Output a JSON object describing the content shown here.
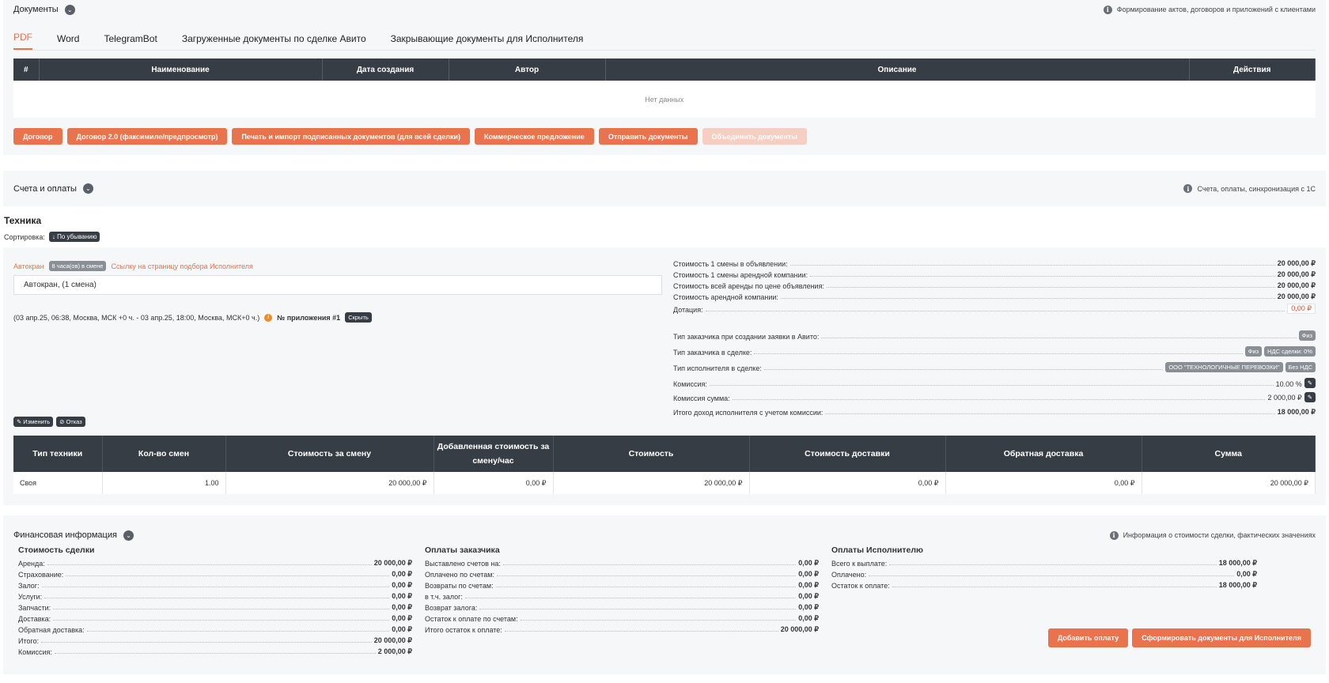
{
  "documents": {
    "title": "Документы",
    "info": "Формирование актов, договоров и приложений с клиентами",
    "tabs": [
      "PDF",
      "Word",
      "TelegramBot",
      "Загруженные документы по сделке Авито",
      "Закрывающие документы для Исполнителя"
    ],
    "table_headers": [
      "#",
      "Наименование",
      "Дата создания",
      "Автор",
      "Описание",
      "Действия"
    ],
    "empty_text": "Нет данных",
    "buttons": [
      "Договор",
      "Договор 2.0 (факсимиле/предпросмотр)",
      "Печать и импорт подписанных документов (для всей сделки)",
      "Коммерческое предложение",
      "Отправить документы",
      "Объединить документы"
    ]
  },
  "invoices": {
    "title": "Счета и оплаты",
    "info": "Счета, оплаты, синхронизация с 1С"
  },
  "tech": {
    "title": "Техника",
    "sort_label": "Сортировка:",
    "sort_value": "↓ По убыванию",
    "item_name": "Автокран",
    "hours_badge": "8 часа(ов) в смене",
    "link": "Ссылку на страницу подбора Исполнителя",
    "input_value": "Автокран, (1 смена)",
    "period": "(03 апр.25, 06:38, Москва, МСК +0 ч. - 03 апр.25, 18:00, Москва, МСК+0 ч.)",
    "appendix": "№ приложения #1",
    "hide": "Скрыть",
    "edit": "Изменить",
    "refuse": "Отказ",
    "costs": [
      {
        "k": "Стоимость 1 смены в объявлении:",
        "v": "20 000,00 ₽"
      },
      {
        "k": "Стоимость 1 смены арендной компании:",
        "v": "20 000,00 ₽"
      },
      {
        "k": "Стоимость всей аренды по цене объявления:",
        "v": "20 000,00 ₽"
      },
      {
        "k": "Стоимость арендной компании:",
        "v": "20 000,00 ₽"
      },
      {
        "k": "Дотация:",
        "v": "0,00 ₽"
      }
    ],
    "customer_type_avito": {
      "k": "Тип заказчика при создании заявки в Авито:",
      "badge": "Физ"
    },
    "customer_type_deal": {
      "k": "Тип заказчика в сделке:",
      "badge1": "Физ",
      "badge2": "НДС сделки: 0%"
    },
    "executor_type": {
      "k": "Тип исполнителя в сделке:",
      "badge1": "ООО \"ТЕХНОЛОГИЧНЫЕ ПЕРЕВОЗКИ\"",
      "badge2": "Без НДС"
    },
    "commission": {
      "k": "Комиссия:",
      "v": "10.00 %"
    },
    "commission_sum": {
      "k": "Комиссия сумма:",
      "v": "2 000,00 ₽"
    },
    "total_income": {
      "k": "Итого доход исполнителя с учетом комиссии:",
      "v": "18 000,00 ₽"
    },
    "table_headers": [
      "Тип техники",
      "Кол-во смен",
      "Стоимость за смену",
      "Добавленная стоимость за смену/час",
      "Стоимость",
      "Стоимость доставки",
      "Обратная доставка",
      "Сумма"
    ],
    "row": [
      "Своя",
      "1.00",
      "20 000,00 ₽",
      "0,00 ₽",
      "20 000,00 ₽",
      "0,00 ₽",
      "0,00 ₽",
      "20 000,00 ₽"
    ]
  },
  "finance": {
    "title": "Финансовая информация",
    "info": "Информация о стоимости сделки, фактических значениях",
    "deal": {
      "title": "Стоимость сделки",
      "rows": [
        {
          "k": "Аренда:",
          "v": "20 000,00 ₽"
        },
        {
          "k": "Страхование:",
          "v": "0,00 ₽"
        },
        {
          "k": "Залог:",
          "v": "0,00 ₽"
        },
        {
          "k": "Услуги:",
          "v": "0,00 ₽"
        },
        {
          "k": "Запчасти:",
          "v": "0,00 ₽"
        },
        {
          "k": "Доставка:",
          "v": "0,00 ₽"
        },
        {
          "k": "Обратная доставка:",
          "v": "0,00 ₽"
        },
        {
          "k": "Итого:",
          "v": "20 000,00 ₽"
        },
        {
          "k": "Комиссия:",
          "v": "2 000,00 ₽"
        }
      ]
    },
    "customer": {
      "title": "Оплаты заказчика",
      "rows": [
        {
          "k": "Выставлено счетов на:",
          "v": "0,00 ₽"
        },
        {
          "k": "Оплачено по счетам:",
          "v": "0,00 ₽"
        },
        {
          "k": "Возвраты по счетам:",
          "v": "0,00 ₽"
        },
        {
          "k": "в т.ч. залог:",
          "v": "0,00 ₽"
        },
        {
          "k": "Возврат залога:",
          "v": "0,00 ₽"
        },
        {
          "k": "Остаток к оплате по счетам:",
          "v": "0,00 ₽"
        },
        {
          "k": "Итого остаток к оплате:",
          "v": "20 000,00 ₽"
        }
      ]
    },
    "executor": {
      "title": "Оплаты Исполнителю",
      "rows": [
        {
          "k": "Всего к выплате:",
          "v": "18 000,00 ₽"
        },
        {
          "k": "Оплачено:",
          "v": "0,00 ₽"
        },
        {
          "k": "Остаток к оплате:",
          "v": "18 000,00 ₽"
        }
      ]
    },
    "buttons": [
      "Добавить оплату",
      "Сформировать документы для Исполнителя"
    ]
  }
}
